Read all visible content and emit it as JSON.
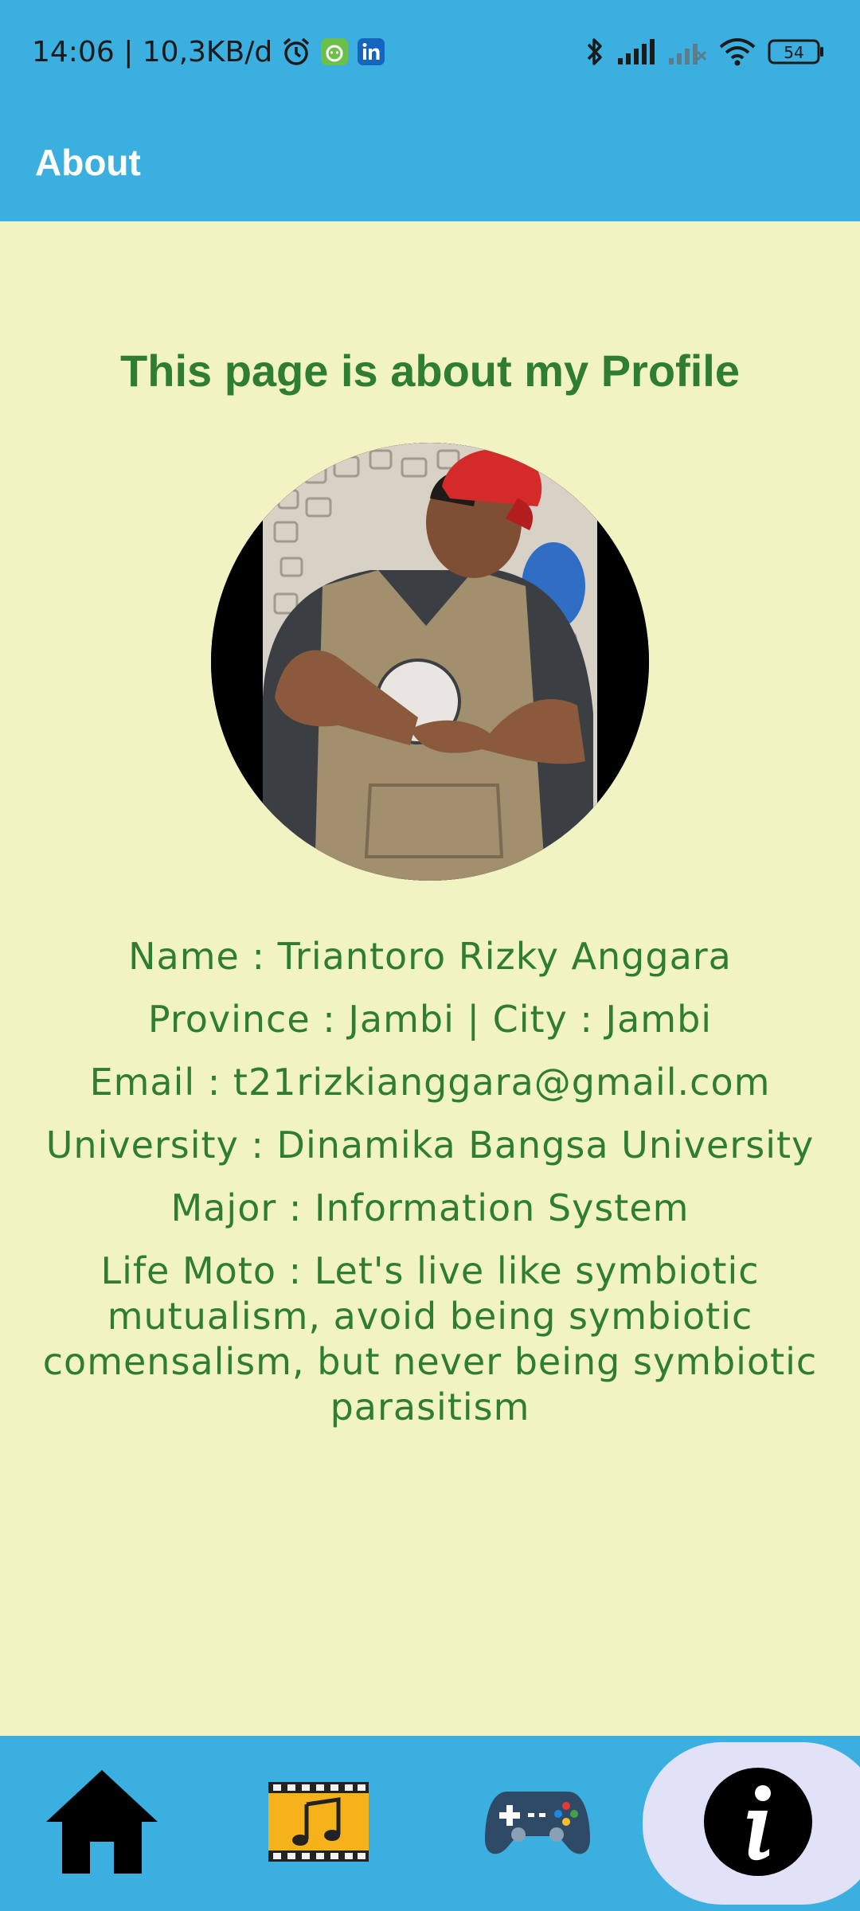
{
  "status_bar": {
    "time_speed": "14:06 | 10,3KB/d",
    "battery": "54",
    "icons": [
      "alarm-icon",
      "android-app-icon",
      "linkedin-icon",
      "bluetooth-icon",
      "signal-icon",
      "signal-off-icon",
      "wifi-icon",
      "battery-icon"
    ]
  },
  "app_bar": {
    "title": "About"
  },
  "page": {
    "heading": "This page is about my Profile",
    "profile": {
      "name": "Name : Triantoro Rizky Anggara",
      "location": "Province : Jambi | City : Jambi",
      "email": "Email : t21rizkianggara@gmail.com",
      "university": "University : Dinamika Bangsa University",
      "major": "Major : Information System",
      "life_moto": "Life Moto : Let's live like symbiotic mutualism, avoid being symbiotic comensalism, but never being symbiotic parasitism"
    }
  },
  "bottom_nav": {
    "items": [
      {
        "icon": "home-icon",
        "active": false
      },
      {
        "icon": "music-film-icon",
        "active": false
      },
      {
        "icon": "gamepad-icon",
        "active": false
      },
      {
        "icon": "info-icon",
        "active": true
      }
    ],
    "colors": {
      "bar": "#3aafe0",
      "active_bg": "#e1e1f7"
    }
  },
  "colors": {
    "background": "#f2f3c2",
    "accent": "#3aafe0",
    "text_green": "#2e7d32"
  }
}
